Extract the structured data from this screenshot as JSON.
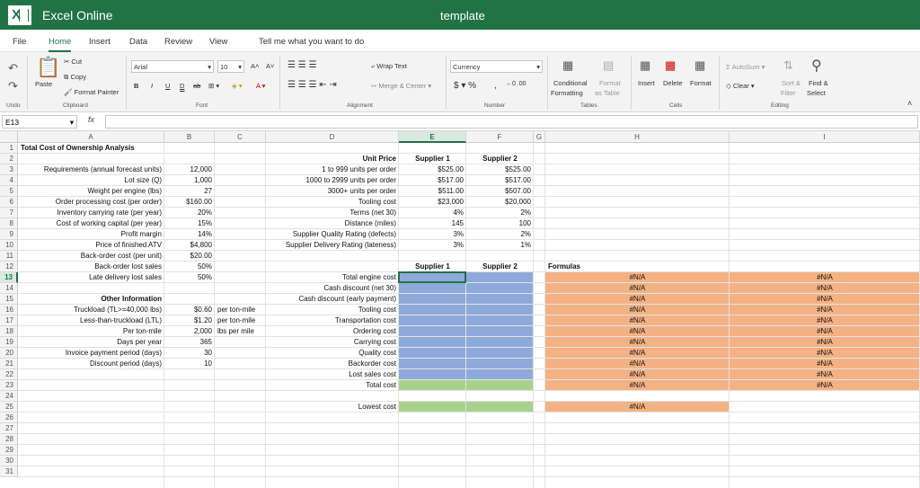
{
  "app": {
    "name": "Excel Online",
    "document_title": "template",
    "logo_letter": "X"
  },
  "menu": [
    "File",
    "Home",
    "Insert",
    "Data",
    "Review",
    "View",
    "Tell me what you want to do"
  ],
  "ribbon": {
    "undo": "Undo",
    "paste": "Paste",
    "cut": "Cut",
    "copy": "Copy",
    "format_painter": "Format Painter",
    "clipboard": "Clipboard",
    "font_name": "Arial",
    "font_size": "10",
    "font_group": "Font",
    "wrap_text": "Wrap Text",
    "merge_center": "Merge & Center",
    "alignment_group": "Alignment",
    "number_format": "Currency",
    "number_group": "Number",
    "conditional_formatting_1": "Conditional",
    "conditional_formatting_2": "Formatting",
    "format_table_1": "Format",
    "format_table_2": "as Table",
    "tables_group": "Tables",
    "insert": "Insert",
    "delete": "Delete",
    "format": "Format",
    "cells_group": "Cells",
    "autosum": "AutoSum",
    "clear": "Clear",
    "sort_filter_1": "Sort &",
    "sort_filter_2": "Filter",
    "find_select_1": "Find &",
    "find_select_2": "Select",
    "editing_group": "Editing"
  },
  "formula_bar": {
    "name_box": "E13",
    "fx": "fx",
    "formula": ""
  },
  "colors": {
    "brand": "#217346",
    "blue_fill": "#8eaadb",
    "green_fill": "#a9d18e",
    "orange_fill": "#f4b183"
  },
  "columns": [
    "A",
    "B",
    "C",
    "D",
    "E",
    "F",
    "G",
    "H",
    "I"
  ],
  "rows": [
    "1",
    "2",
    "3",
    "4",
    "5",
    "6",
    "7",
    "8",
    "9",
    "10",
    "11",
    "12",
    "13",
    "14",
    "15",
    "16",
    "17",
    "18",
    "19",
    "20",
    "21",
    "22",
    "23",
    "24",
    "25",
    "26",
    "27",
    "28",
    "29",
    "30",
    "31"
  ],
  "sheet": {
    "title": "Total Cost of Ownership Analysis",
    "inputs_labels": [
      "Requirements (annual forecast units)",
      "Lot size (Q)",
      "Weight per engine (lbs)",
      "Order processing cost (per order)",
      "Inventory carrying rate (per year)",
      "Cost of working capital (per year)",
      "Profit margin",
      "Price of finished ATV",
      "Back-order cost (per unit)",
      "Back-order lost sales",
      "Late delivery lost sales"
    ],
    "inputs_values": [
      "12,000",
      "1,000",
      "27",
      "$160.00",
      "20%",
      "15%",
      "14%",
      "$4,800",
      "$20.00",
      "50%",
      "50%"
    ],
    "other_info_header": "Other Information",
    "other_labels": [
      "Truckload (TL>=40,000 lbs)",
      "Less-than-truckload (LTL)",
      "Per ton-mile",
      "Days per year",
      "Invoice payment period (days)",
      "Discount period (days)"
    ],
    "other_values": [
      "$0.60",
      "$1.20",
      "2,000",
      "365",
      "30",
      "10"
    ],
    "other_units": [
      "per ton-mile",
      "per ton-mile",
      "lbs per mile",
      "",
      "",
      ""
    ],
    "unit_price_header": "Unit Price",
    "supplier1": "Supplier 1",
    "supplier2": "Supplier 2",
    "price_labels": [
      "1 to 999 units per order",
      "1000 to 2999 units per order",
      "3000+ units per order",
      "Tooling cost",
      "Terms (net 30)",
      "Distance (miles)",
      "Supplier Quality Rating (defects)",
      "Supplier Delivery Rating (lateness)"
    ],
    "supplier1_values": [
      "$525.00",
      "$517.00",
      "$511.00",
      "$23,000",
      "4%",
      "145",
      "3%",
      "3%"
    ],
    "supplier2_values": [
      "$525.00",
      "$517.00",
      "$507.00",
      "$20,000",
      "2%",
      "100",
      "2%",
      "1%"
    ],
    "formulas_header": "Formulas",
    "cost_labels": [
      "Total engine cost",
      "Cash discount (net 30)",
      "Cash discount (early payment)",
      "Tooling cost",
      "Transportation cost",
      "Ordering cost",
      "Carrying cost",
      "Quality cost",
      "Backorder cost",
      "Lost sales cost",
      "Total cost"
    ],
    "lowest_cost_label": "Lowest cost",
    "na": "#N/A"
  }
}
